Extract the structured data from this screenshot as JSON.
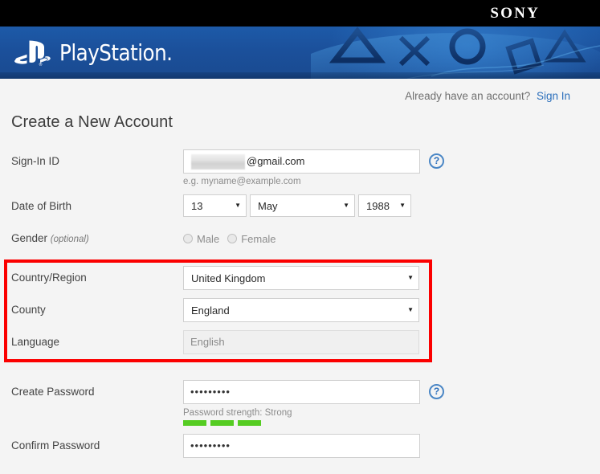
{
  "brand": {
    "sony_logo": "SONY",
    "playstation_wordmark": "PlayStation.",
    "banner_icon_names": [
      "triangle-icon",
      "cross-icon",
      "circle-icon",
      "square-icon"
    ],
    "banner_blue": "#1b4f9c",
    "black_bar": "#000000"
  },
  "header": {
    "already_have_account": "Already have an account?",
    "sign_in_link": "Sign In",
    "page_title": "Create a New Account",
    "link_color": "#2a6ebb"
  },
  "form": {
    "signin_id": {
      "label": "Sign-In ID",
      "masked_prefix": "",
      "value_suffix": "@gmail.com",
      "hint": "e.g. myname@example.com",
      "help_icon": "?"
    },
    "date_of_birth": {
      "label": "Date of Birth",
      "day": "13",
      "month": "May",
      "year": "1988",
      "caret": "▼"
    },
    "gender": {
      "label": "Gender",
      "optional_note": "(optional)",
      "options": [
        "Male",
        "Female"
      ],
      "selected": ""
    },
    "country_region": {
      "label": "Country/Region",
      "value": "United Kingdom",
      "caret": "▼"
    },
    "county": {
      "label": "County",
      "value": "England",
      "caret": "▼"
    },
    "language": {
      "label": "Language",
      "value": "English"
    },
    "create_password": {
      "label": "Create Password",
      "value": "•••••••••",
      "help_icon": "?",
      "strength_text": "Password strength: Strong",
      "strength_filled": 3,
      "strength_color": "#55cc22"
    },
    "confirm_password": {
      "label": "Confirm Password",
      "value": "•••••••••"
    }
  },
  "annotation": {
    "highlight_color": "#fb0000",
    "highlight_target": "country-county-language-group"
  }
}
